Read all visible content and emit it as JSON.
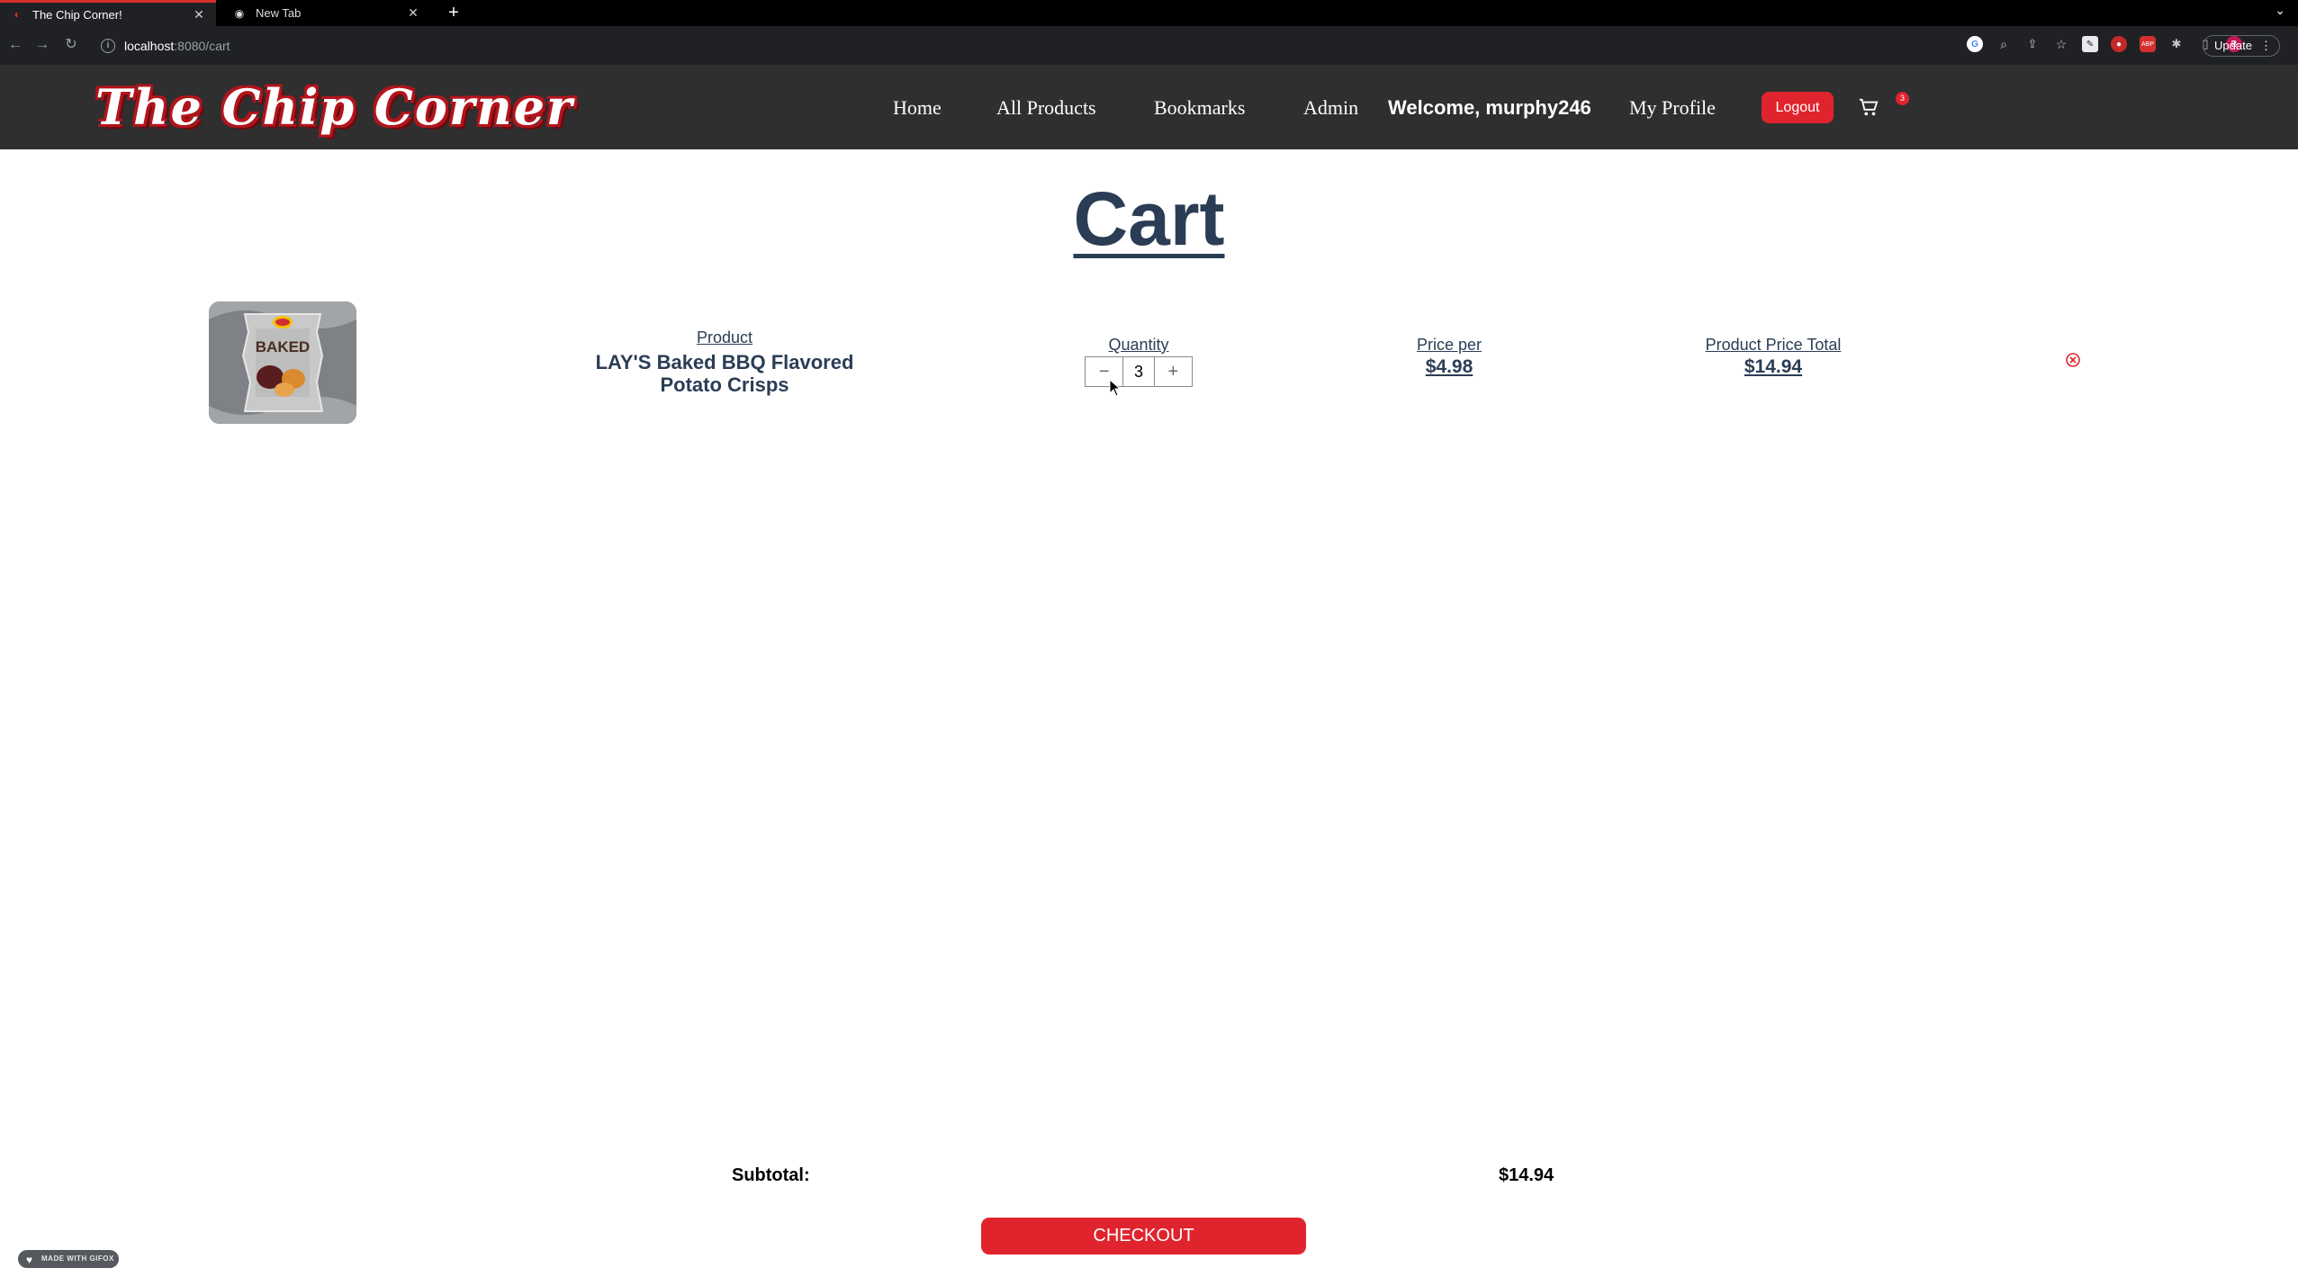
{
  "browser": {
    "tabs": [
      {
        "title": "The Chip Corner!",
        "active": true
      },
      {
        "title": "New Tab",
        "active": false
      }
    ],
    "url_host": "localhost",
    "url_rest": ":8080/cart",
    "update_label": "Update",
    "profile_initial": "B"
  },
  "header": {
    "logo_text": "The Chip Corner",
    "nav": {
      "home": "Home",
      "all_products": "All Products",
      "bookmarks": "Bookmarks",
      "admin": "Admin",
      "welcome": "Welcome, murphy246",
      "my_profile": "My Profile"
    },
    "logout_label": "Logout",
    "cart_count": "3"
  },
  "page": {
    "title": "Cart"
  },
  "cart": {
    "columns": {
      "product": "Product",
      "quantity": "Quantity",
      "price_per": "Price per",
      "total": "Product Price Total"
    },
    "items": [
      {
        "image_caption": "BAKED",
        "name_line1": "LAY'S Baked BBQ Flavored",
        "name_line2": "Potato Crisps",
        "quantity": "3",
        "price_per": "$4.98",
        "total": "$14.94",
        "minus": "−",
        "plus": "+"
      }
    ],
    "subtotal_label": "Subtotal:",
    "subtotal_value": "$14.94",
    "checkout_label": "CHECKOUT"
  },
  "overlay": {
    "gifox_badge": "MADE WITH GIFOX"
  },
  "colors": {
    "accent_red": "#e0242e",
    "heading_blue": "#2b3d55",
    "header_bg": "#2f2f2f"
  }
}
